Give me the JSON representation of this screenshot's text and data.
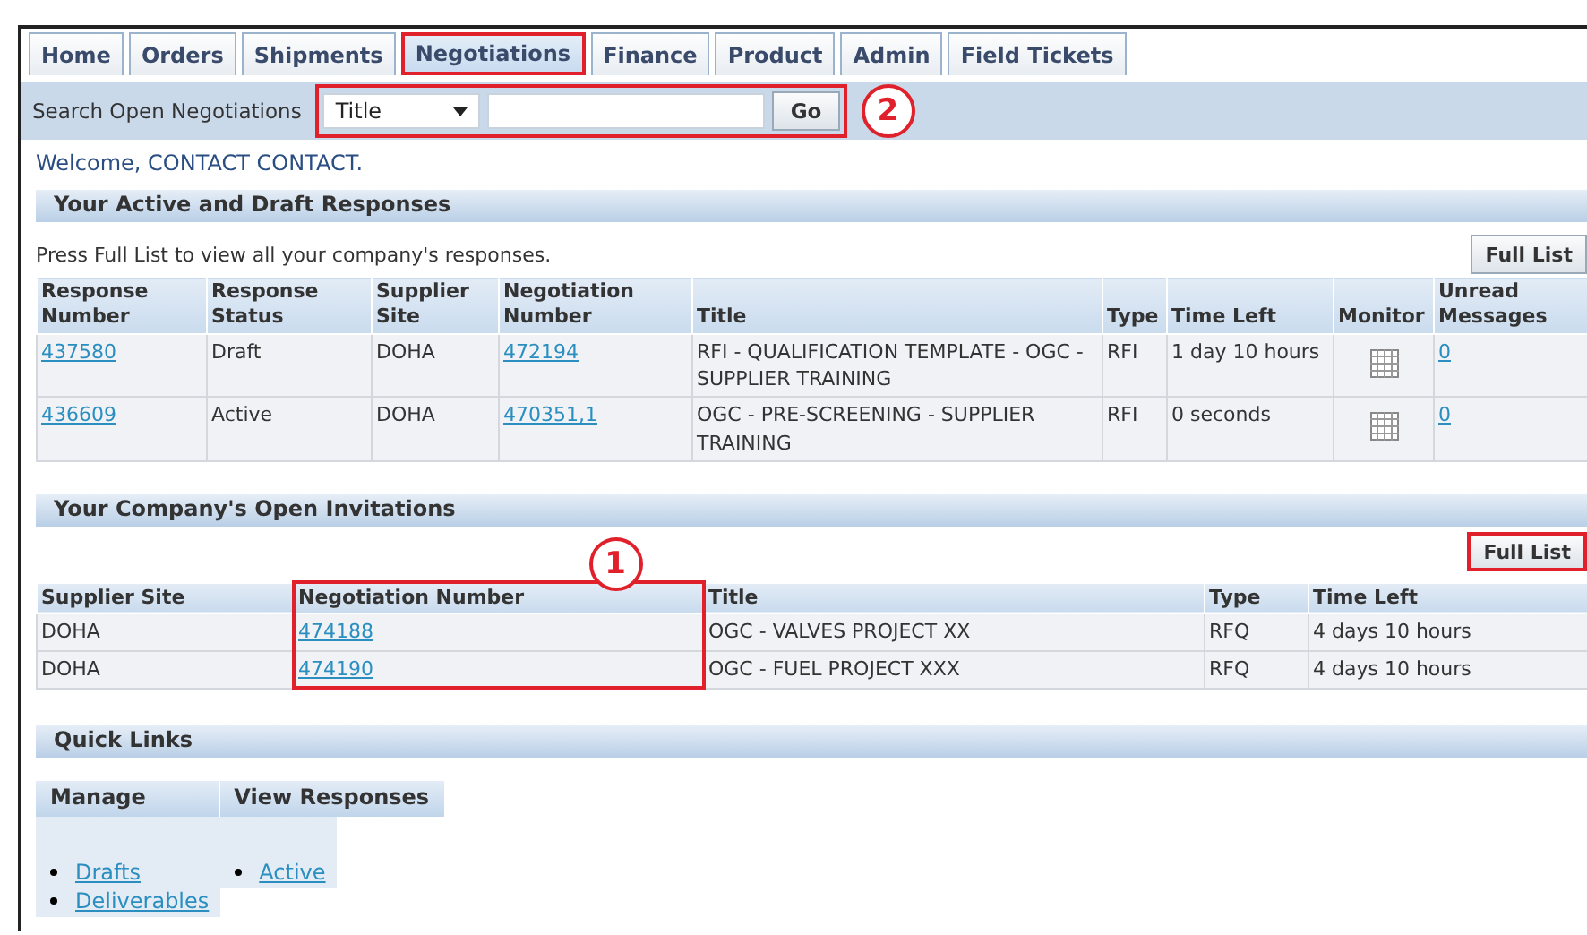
{
  "tabs": [
    {
      "label": "Home",
      "selected": false,
      "callout": false
    },
    {
      "label": "Orders",
      "selected": false,
      "callout": false
    },
    {
      "label": "Shipments",
      "selected": false,
      "callout": false
    },
    {
      "label": "Negotiations",
      "selected": true,
      "callout": true
    },
    {
      "label": "Finance",
      "selected": false,
      "callout": false
    },
    {
      "label": "Product",
      "selected": false,
      "callout": false
    },
    {
      "label": "Admin",
      "selected": false,
      "callout": false
    },
    {
      "label": "Field Tickets",
      "selected": false,
      "callout": false
    }
  ],
  "search": {
    "label": "Search Open Negotiations",
    "attribute": "Title",
    "button": "Go",
    "callout": true,
    "badge": "2"
  },
  "welcome": "Welcome, CONTACT CONTACT.",
  "responses": {
    "title": "Your Active and Draft Responses",
    "hint": "Press Full List to view all your company's responses.",
    "full_list": {
      "label": "Full List",
      "callout": false
    },
    "columns": [
      "Response Number",
      "Response Status",
      "Supplier Site",
      "Negotiation Number",
      "Title",
      "Type",
      "Time Left",
      "Monitor",
      "Unread Messages"
    ],
    "rows": [
      {
        "response_number": "437580",
        "status": "Draft",
        "site": "DOHA",
        "negotiation_number": "472194",
        "title": "RFI - QUALIFICATION TEMPLATE - OGC - SUPPLIER TRAINING",
        "type": "RFI",
        "time_left": "1 day 10 hours",
        "unread": "0"
      },
      {
        "response_number": "436609",
        "status": "Active",
        "site": "DOHA",
        "negotiation_number": "470351,1",
        "title": "OGC - PRE-SCREENING - SUPPLIER TRAINING",
        "type": "RFI",
        "time_left": "0 seconds",
        "unread": "0"
      }
    ]
  },
  "invitations": {
    "title": "Your Company's Open Invitations",
    "full_list": {
      "label": "Full List",
      "callout": true
    },
    "columns": [
      {
        "label": "Supplier Site",
        "callout": false
      },
      {
        "label": "Negotiation Number",
        "callout": true,
        "badge": "1"
      },
      {
        "label": "Title",
        "callout": false
      },
      {
        "label": "Type",
        "callout": false
      },
      {
        "label": "Time Left",
        "callout": false
      }
    ],
    "rows": [
      {
        "site": "DOHA",
        "negotiation_number": "474188",
        "title": "OGC - VALVES PROJECT XX",
        "type": "RFQ",
        "time_left": "4 days 10 hours"
      },
      {
        "site": "DOHA",
        "negotiation_number": "474190",
        "title": "OGC - FUEL PROJECT XXX",
        "type": "RFQ",
        "time_left": "4 days 10 hours"
      }
    ]
  },
  "quick_links": {
    "title": "Quick Links",
    "groups": [
      {
        "title": "Manage",
        "links": [
          "Drafts",
          "Deliverables"
        ]
      },
      {
        "title": "View Responses",
        "links": [
          "Active"
        ]
      }
    ]
  }
}
